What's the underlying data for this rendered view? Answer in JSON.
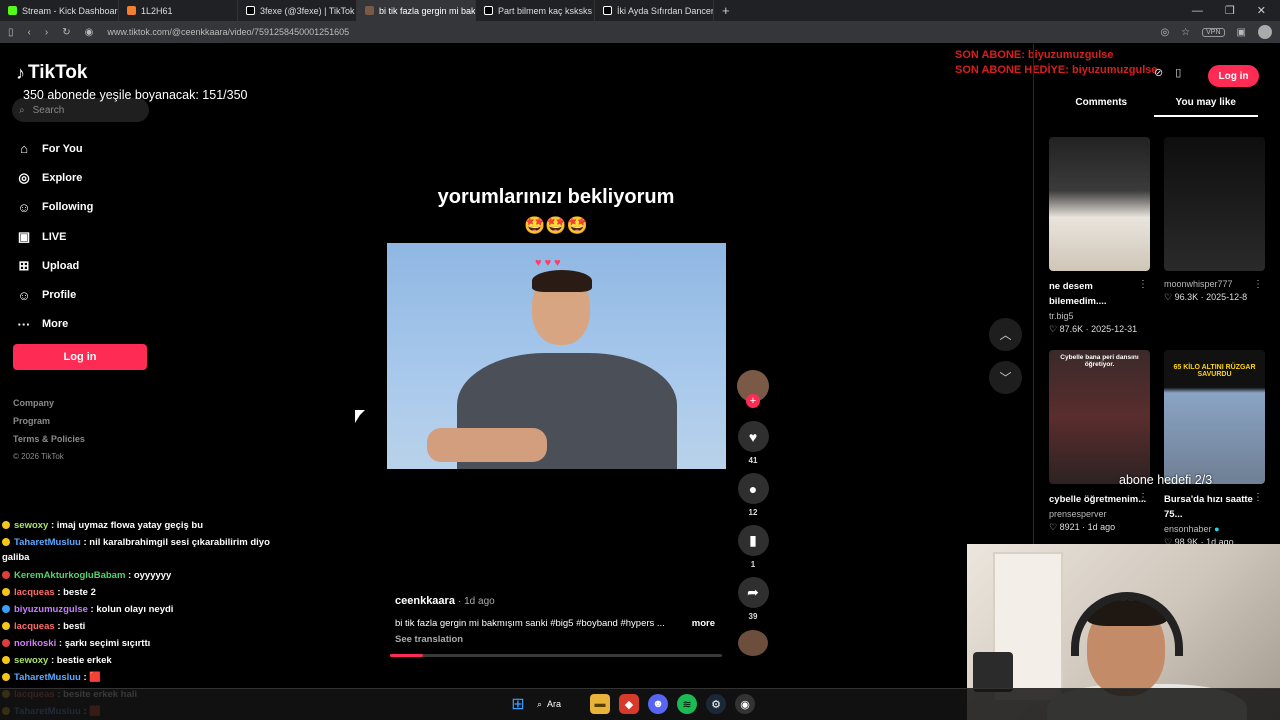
{
  "browser": {
    "tabs": [
      {
        "label": "Stream - Kick Dashboard",
        "color": "#53fc18"
      },
      {
        "label": "1L2H61",
        "color": "#f0802e"
      },
      {
        "label": "3fexe (@3fexe) | TikTok",
        "color": "#ffffff"
      },
      {
        "label": "bi tik fazla gergin mi bakmış",
        "color": "#ffffff"
      },
      {
        "label": "Part bilmem kaç ksksks . #al",
        "color": "#ffffff"
      },
      {
        "label": "İki Ayda Sıfırdan Dancer Ol",
        "color": "#ffffff"
      }
    ],
    "new_tab": "+",
    "url": "www.tiktok.com/@ceenkkaara/video/7591258450001251605",
    "vpn": "VPN"
  },
  "tiktok": {
    "logo": "TikTok",
    "search_placeholder": "Search",
    "nav": [
      {
        "label": "For You",
        "icon": "home-icon"
      },
      {
        "label": "Explore",
        "icon": "compass-icon"
      },
      {
        "label": "Following",
        "icon": "users-icon"
      },
      {
        "label": "LIVE",
        "icon": "live-icon"
      },
      {
        "label": "Upload",
        "icon": "upload-icon"
      },
      {
        "label": "Profile",
        "icon": "profile-icon"
      },
      {
        "label": "More",
        "icon": "more-icon"
      }
    ],
    "login_left": "Log in",
    "footer": [
      "Company",
      "Program",
      "Terms & Policies"
    ],
    "copyright": "© 2026 TikTok",
    "login_top": "Log in",
    "right_tabs": [
      "Comments",
      "You may like"
    ],
    "video": {
      "caption": "yorumlarınızı bekliyorum",
      "emojis": "🤩🤩🤩",
      "author": "ceenkkaara",
      "time": "· 1d ago",
      "description": "bi tik fazla gergin mi bakmışım sanki #big5 #boyband #hypers ...",
      "more": "more",
      "see_translation": "See translation",
      "progress": 0.1
    },
    "actions": {
      "likes": "41",
      "comments": "12",
      "saves": "1",
      "shares": "39"
    },
    "recommendations": [
      {
        "title": "ne desem bilemedim....",
        "author": "tr.big5",
        "views": "87.6K",
        "date": "2025-12-31"
      },
      {
        "title": "",
        "author": "moonwhisper777",
        "views": "96.3K",
        "date": "2025-12-8"
      },
      {
        "title": "cybelle öğretmenim...",
        "author": "prensesperver",
        "views": "8921",
        "date": "1d ago",
        "thumb_text": "Cybelle bana peri dansını öğretiyor."
      },
      {
        "title": "Bursa'da hızı saatte 75...",
        "author": "ensonhaber",
        "views": "98.9K",
        "date": "1d ago",
        "thumb_text": "65 KİLO ALTINI RÜZGAR SAVURDU"
      }
    ]
  },
  "stream": {
    "goal_text": "350 abonede yeşile boyanacak: 151/350",
    "last_sub": "SON ABONE: biyuzumuzgulse",
    "last_gift": "SON ABONE HEDİYE: biyuzumuzgulse",
    "goal2": "abone hedefi 2/3"
  },
  "chat": [
    {
      "user": "sewoxy",
      "msg": ": imaj uymaz flowa yatay geçiş bu",
      "color": "#a8e06a",
      "badge": "#f5c518"
    },
    {
      "user": "TaharetMusluu",
      "msg": ": nil karalbrahimgil sesi çıkarabilirim diyo galiba",
      "color": "#5aa9ff",
      "badge": "#f5c518",
      "wrap": true
    },
    {
      "user": "KeremAkturkogluBabam",
      "msg": ": oyyyyyy",
      "color": "#54d36a",
      "badge": "#e03d3d"
    },
    {
      "user": "lacqueas",
      "msg": ": beste 2",
      "color": "#ff6b6b",
      "badge": "#f5c518"
    },
    {
      "user": "biyuzumuzgulse",
      "msg": ": kolun olayı neydi",
      "color": "#c77dff",
      "badge": "#3aa0ff"
    },
    {
      "user": "lacqueas",
      "msg": ": besti",
      "color": "#ff6b6b",
      "badge": "#f5c518"
    },
    {
      "user": "norikoski",
      "msg": ": şarkı seçimi sıçırttı",
      "color": "#d77bff",
      "badge": "#e03d3d"
    },
    {
      "user": "sewoxy",
      "msg": ": bestie erkek",
      "color": "#a8e06a",
      "badge": "#f5c518"
    },
    {
      "user": "TaharetMusluu",
      "msg": ": 🟥",
      "color": "#5aa9ff",
      "badge": "#f5c518"
    },
    {
      "user": "lacqueas",
      "msg": ": besite erkek hali",
      "color": "#ff6b6b",
      "badge": "#f5c518"
    },
    {
      "user": "TaharetMusluu",
      "msg": ": 🟥",
      "color": "#5aa9ff",
      "badge": "#f5c518"
    }
  ],
  "taskbar": {
    "search_label": "Ara"
  }
}
